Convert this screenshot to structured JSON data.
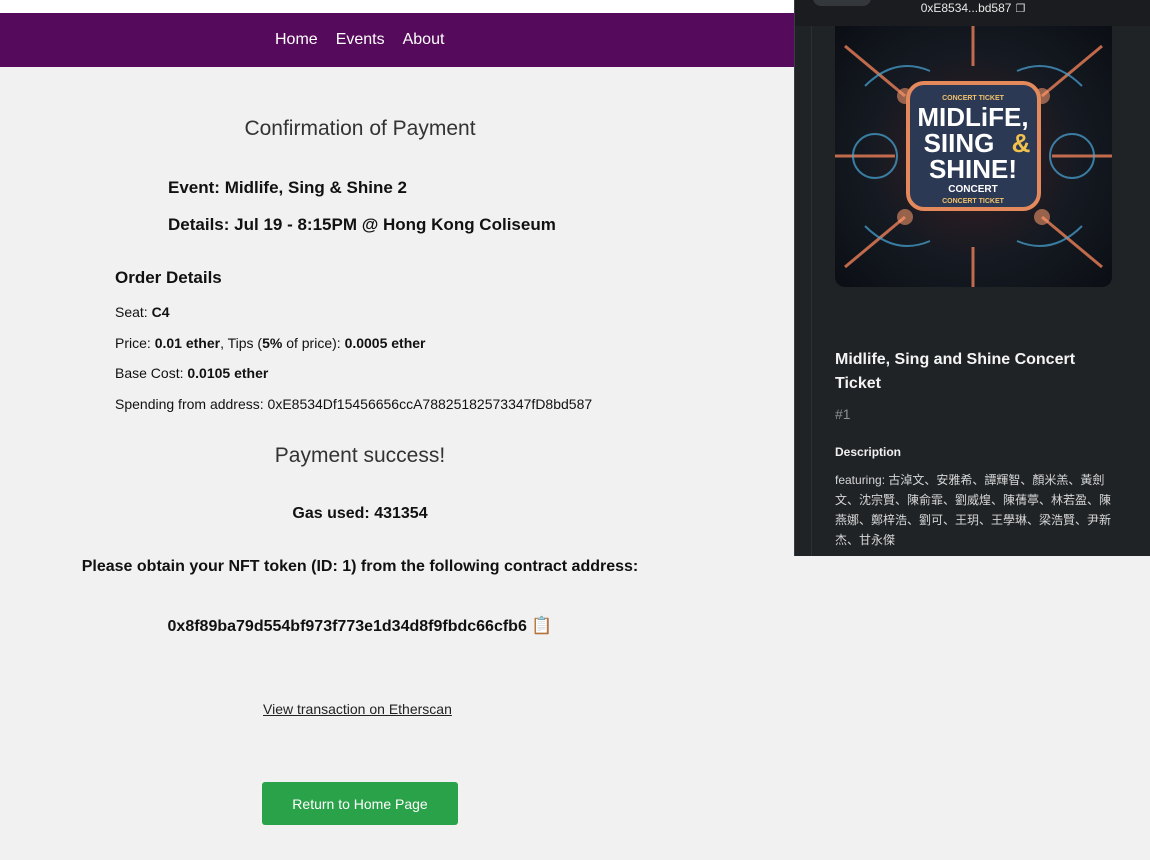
{
  "nav": {
    "links": [
      "Home",
      "Events",
      "About"
    ]
  },
  "confirmation": {
    "title": "Confirmation of Payment",
    "event_label": "Event:",
    "event_value": "Midlife, Sing & Shine 2",
    "details_label": "Details:",
    "details_value": "Jul 19 - 8:15PM @ Hong Kong Coliseum",
    "order_heading": "Order Details",
    "seat_label": "Seat: ",
    "seat_value": "C4",
    "price_label": "Price: ",
    "price_value": "0.01 ether",
    "tips_label": ", Tips (",
    "tips_pct": "5%",
    "tips_mid": " of price): ",
    "tips_value": "0.0005 ether",
    "base_label": "Base Cost: ",
    "base_value": "0.0105 ether",
    "spending_label": "Spending from address: ",
    "spending_value": "0xE8534Df15456656ccA78825182573347fD8bd587",
    "success": "Payment success!",
    "gas": "Gas used: 431354",
    "obtain": "Please obtain your NFT token (ID: 1) from the following contract address:",
    "contract_address": "0x8f89ba79d554bf973f773e1d34d8f9fbdc66cfb6",
    "clipboard_icon": "📋",
    "etherscan_link": "View transaction on Etherscan",
    "home_button": "Return to Home Page"
  },
  "wallet": {
    "address": "0xE8534...bd587",
    "nft_art_text": {
      "top": "CONCERT TICKET",
      "line1": "MIDLiFE,",
      "line2a": "SIING",
      "line2b": "&",
      "line3": "SHINE!",
      "line4": "CONCERT",
      "bottom": "CONCERT TICKET"
    },
    "nft_title": "Midlife, Sing and Shine Concert Ticket",
    "nft_id": "#1",
    "description_heading": "Description",
    "description": "featuring: 古淖文、安雅希、譚輝智、顏米羔、黃劍文、沈宗賢、陳俞霏、劉威煌、陳蒨葶、林若盈、陳燕娜、鄭梓浩、劉可、王玥、王學琳、梁浩賢、尹新杰、甘永傑"
  }
}
